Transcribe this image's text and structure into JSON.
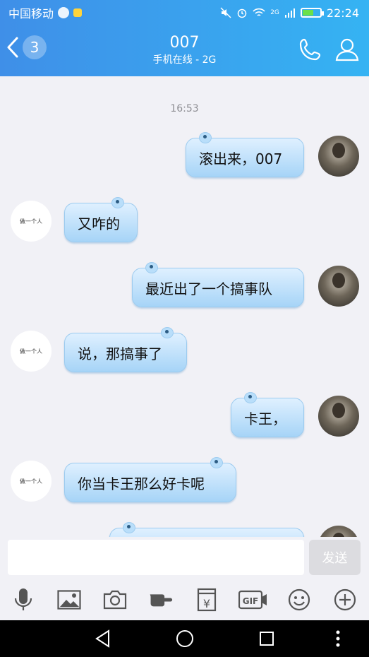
{
  "status": {
    "carrier": "中国移动",
    "network": "2G",
    "time": "22:24"
  },
  "header": {
    "back_count": "3",
    "title": "007",
    "subtitle": "手机在线 - 2G"
  },
  "chat": {
    "timestamp": "16:53",
    "other_avatar_text": "做一个人",
    "messages": [
      {
        "from": "self",
        "text": "滚出来，007"
      },
      {
        "from": "other",
        "text": "又咋的"
      },
      {
        "from": "self",
        "text": "最近出了一个搞事队"
      },
      {
        "from": "other",
        "text": "说，那搞事了"
      },
      {
        "from": "self",
        "text": "卡王，"
      },
      {
        "from": "other",
        "text": "你当卡王那么好卡呢"
      }
    ]
  },
  "input": {
    "placeholder": "",
    "send_label": "发送"
  },
  "toolbar": {
    "icons": [
      "microphone-icon",
      "image-icon",
      "camera-icon",
      "red-packet-icon",
      "transfer-icon",
      "gif-icon",
      "emoji-icon",
      "plus-icon"
    ],
    "gif_label": "GIF",
    "yuan_label": "¥"
  },
  "colors": {
    "header_start": "#3f8fe8",
    "header_end": "#35b3f3",
    "bubble": "#a6d4f7",
    "icon": "#555555"
  }
}
